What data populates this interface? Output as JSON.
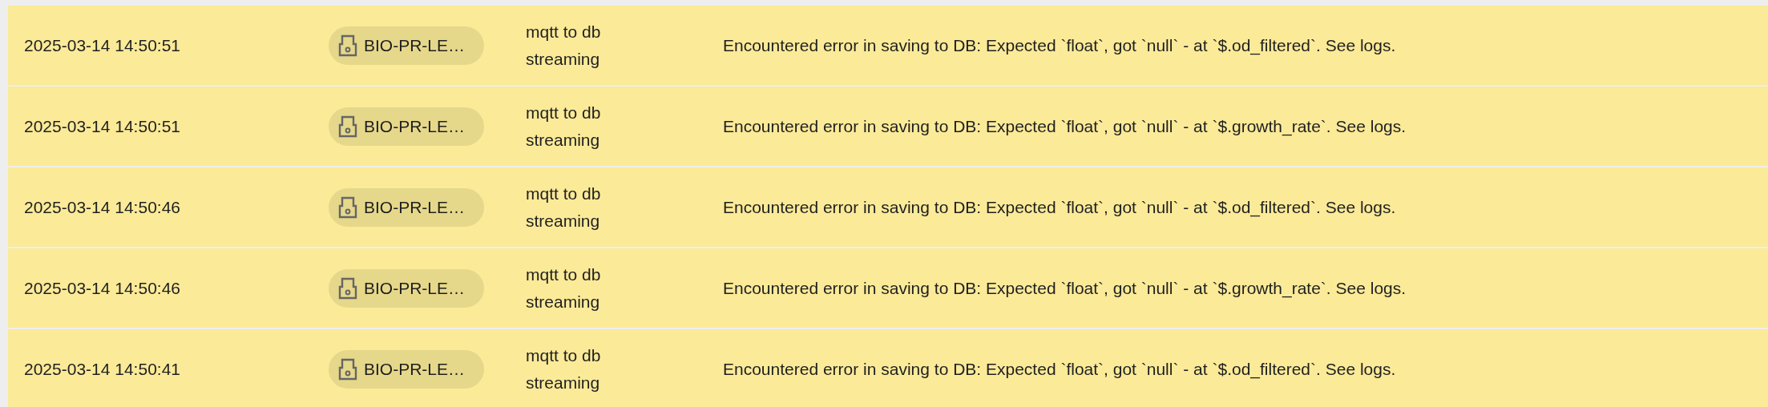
{
  "rows": [
    {
      "highlighted": true,
      "time": "2025-03-14 14:50:51",
      "device": "BIO-PR-LE…",
      "source": "mqtt to db streaming",
      "message": "Encountered error in saving to DB: Expected `float`, got `null` - at `$.od_filtered`. See logs."
    },
    {
      "highlighted": true,
      "time": "2025-03-14 14:50:51",
      "device": "BIO-PR-LE…",
      "source": "mqtt to db streaming",
      "message": "Encountered error in saving to DB: Expected `float`, got `null` - at `$.growth_rate`. See logs."
    },
    {
      "highlighted": true,
      "time": "2025-03-14 14:50:46",
      "device": "BIO-PR-LE…",
      "source": "mqtt to db streaming",
      "message": "Encountered error in saving to DB: Expected `float`, got `null` - at `$.od_filtered`. See logs."
    },
    {
      "highlighted": true,
      "time": "2025-03-14 14:50:46",
      "device": "BIO-PR-LE…",
      "source": "mqtt to db streaming",
      "message": "Encountered error in saving to DB: Expected `float`, got `null` - at `$.growth_rate`. See logs."
    },
    {
      "highlighted": true,
      "time": "2025-03-14 14:50:41",
      "device": "BIO-PR-LE…",
      "source": "mqtt to db streaming",
      "message": "Encountered error in saving to DB: Expected `float`, got `null` - at `$.od_filtered`. See logs."
    }
  ]
}
